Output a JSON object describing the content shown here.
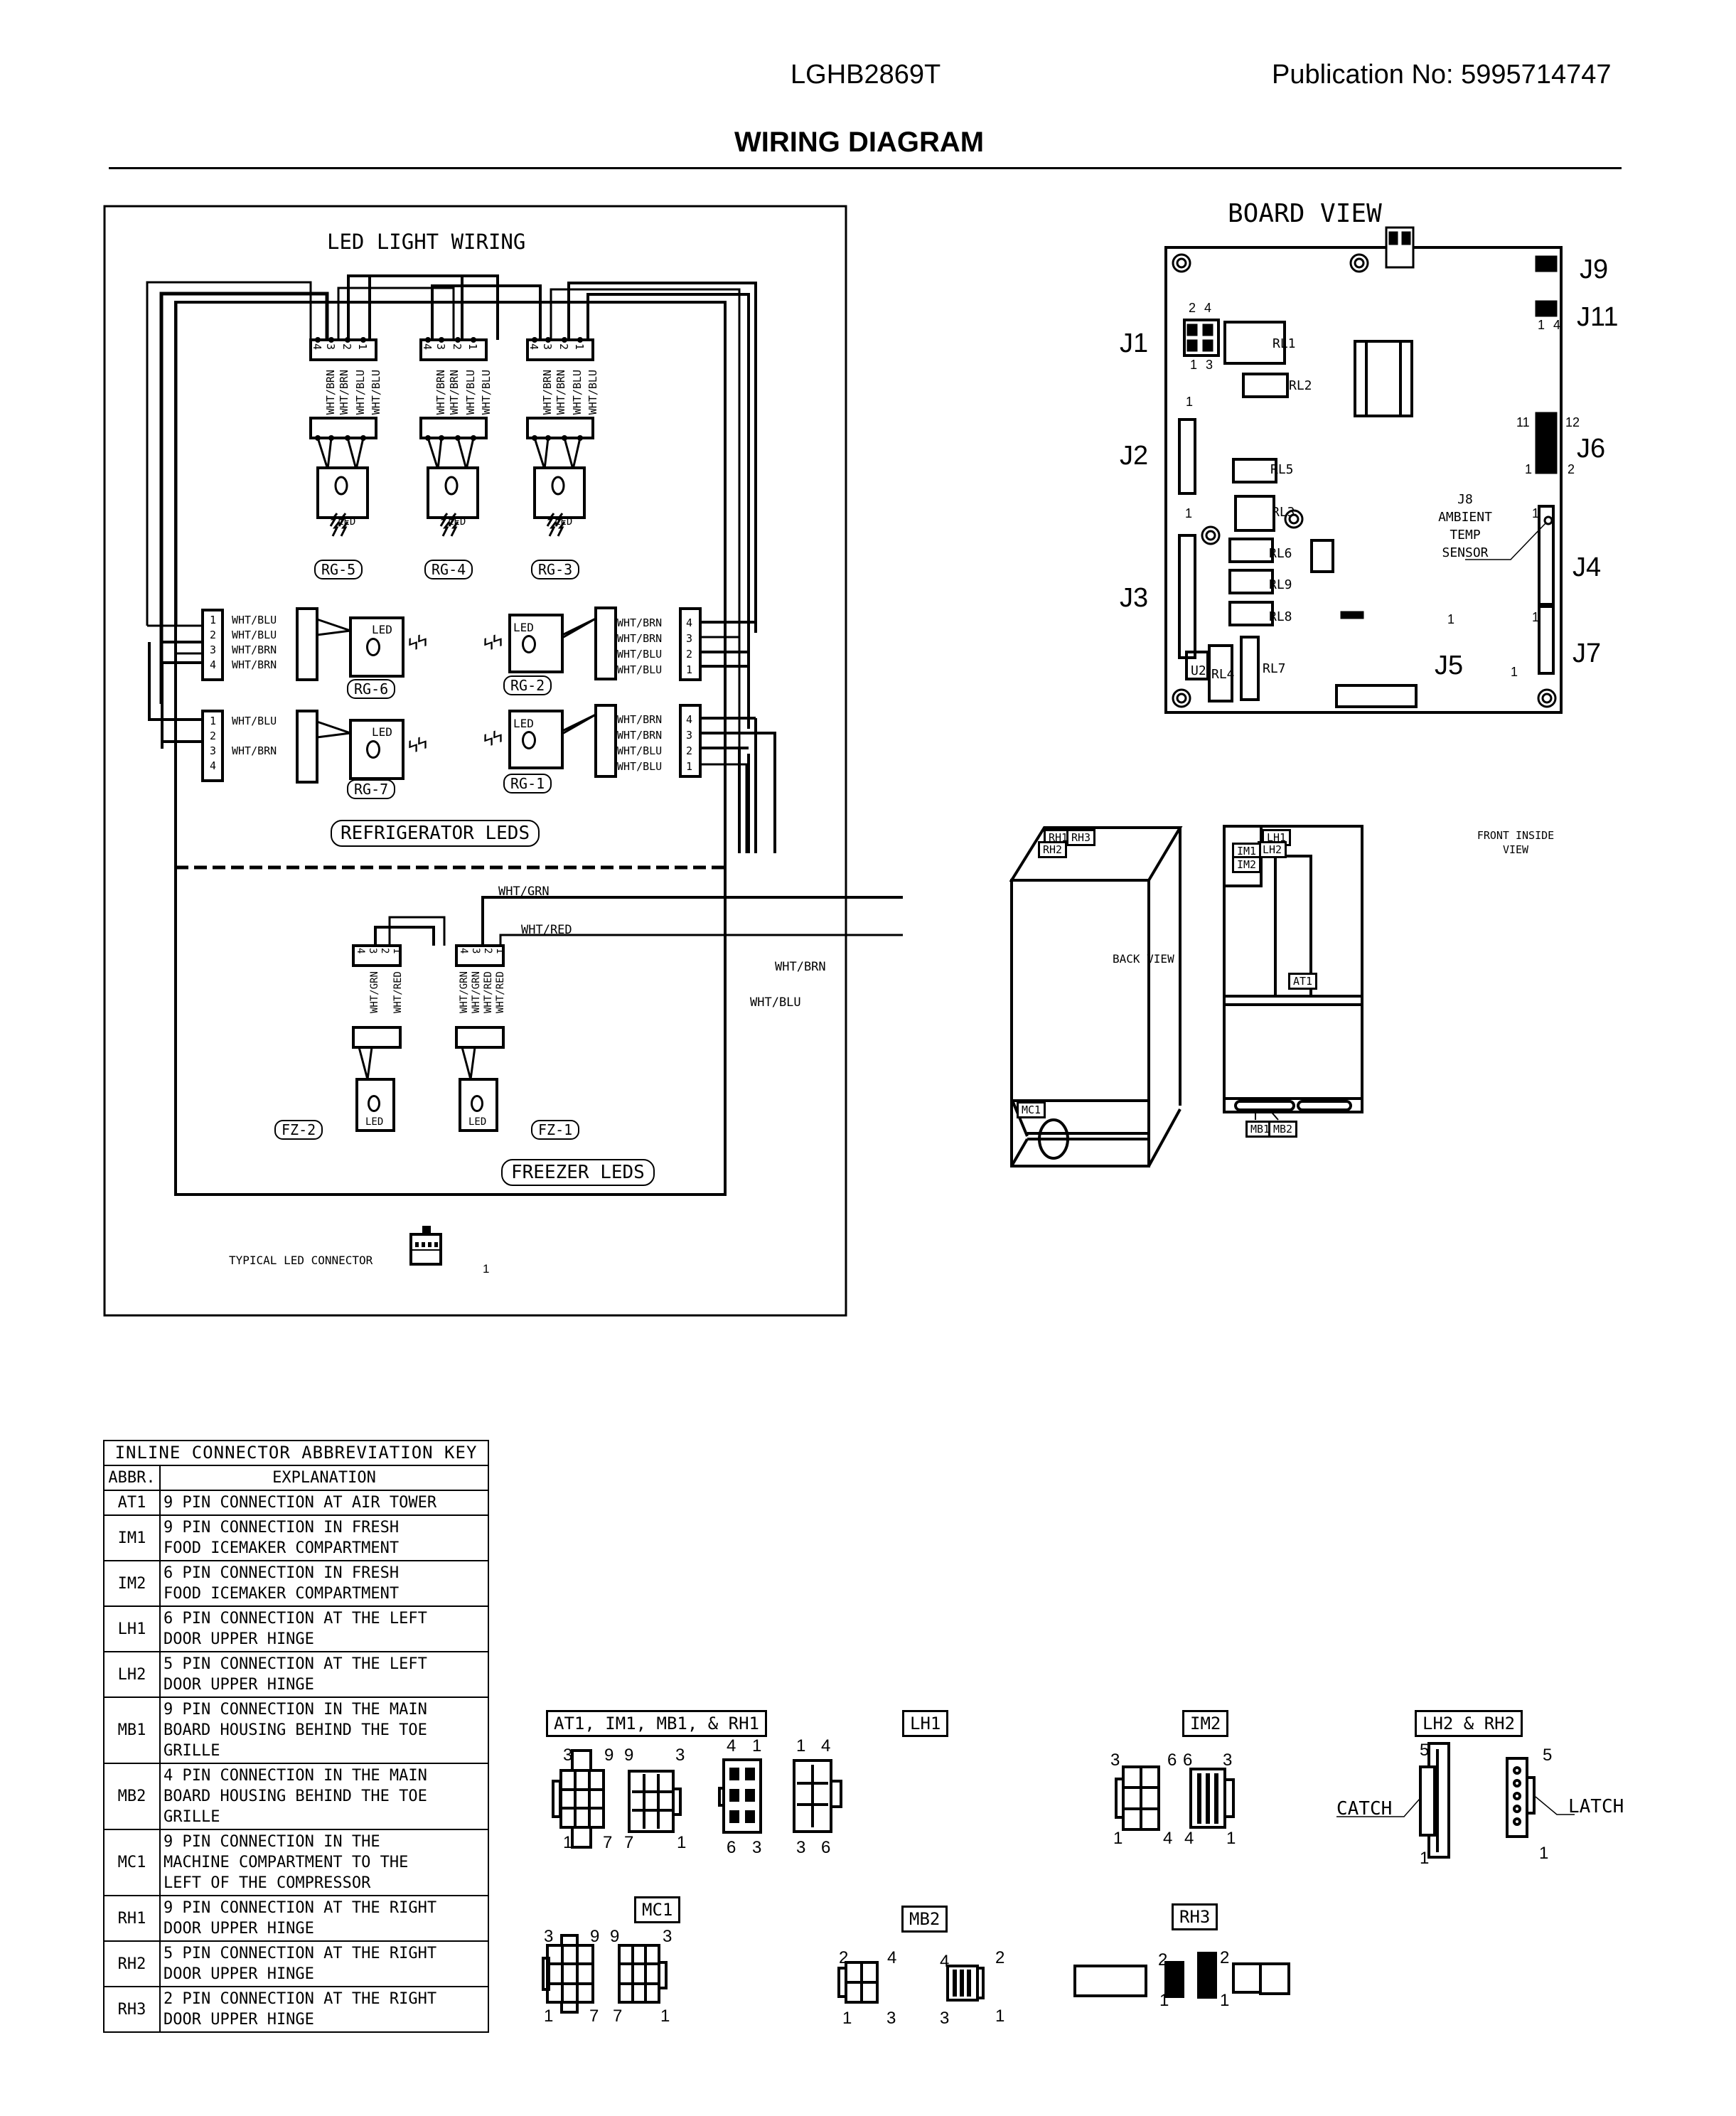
{
  "header": {
    "model": "LGHB2869T",
    "publication": "Publication No:  5995714747",
    "title": "WIRING DIAGRAM"
  },
  "led_panel": {
    "title": "LED LIGHT WIRING",
    "top_connectors": [
      {
        "label": "RG-5",
        "pins": [
          "4",
          "3",
          "2",
          "1"
        ],
        "wires": [
          "WHT/BRN",
          "WHT/BRN",
          "WHT/BLU",
          "WHT/BLU"
        ],
        "led_text": "LED"
      },
      {
        "label": "RG-4",
        "pins": [
          "4",
          "3",
          "2",
          "1"
        ],
        "wires": [
          "WHT/BRN",
          "WHT/BRN",
          "WHT/BLU",
          "WHT/BLU"
        ],
        "led_text": "LED"
      },
      {
        "label": "RG-3",
        "pins": [
          "4",
          "3",
          "2",
          "1"
        ],
        "wires": [
          "WHT/BRN",
          "WHT/BRN",
          "WHT/BLU",
          "WHT/BLU"
        ],
        "led_text": "LED"
      }
    ],
    "left_connectors": [
      {
        "label": "RG-6",
        "pins": [
          "1",
          "2",
          "3",
          "4"
        ],
        "wires": [
          "WHT/BLU",
          "WHT/BLU",
          "WHT/BRN",
          "WHT/BRN"
        ],
        "led_text": "LED"
      },
      {
        "label": "RG-7",
        "pins": [
          "1",
          "2",
          "3",
          "4"
        ],
        "wires": [
          "WHT/BLU",
          "",
          "WHT/BRN",
          ""
        ],
        "led_text": "LED"
      }
    ],
    "right_connectors": [
      {
        "label": "RG-2",
        "pins": [
          "4",
          "3",
          "2",
          "1"
        ],
        "wires": [
          "WHT/BRN",
          "WHT/BRN",
          "WHT/BLU",
          "WHT/BLU"
        ],
        "led_text": "LED"
      },
      {
        "label": "RG-1",
        "pins": [
          "4",
          "3",
          "2",
          "1"
        ],
        "wires": [
          "WHT/BRN",
          "WHT/BRN",
          "WHT/BLU",
          "WHT/BLU"
        ],
        "led_text": "LED"
      }
    ],
    "refrigerator_label": "REFRIGERATOR LEDS",
    "freezer_label": "FREEZER LEDS",
    "freezer_connectors": [
      {
        "label": "FZ-2",
        "pins": [
          "4",
          "3",
          "2",
          "1"
        ],
        "wires": [
          "WHT/GRN",
          "WHT/RED"
        ],
        "led_text": "LED"
      },
      {
        "label": "FZ-1",
        "pins": [
          "4",
          "3",
          "2",
          "1"
        ],
        "wires": [
          "WHT/GRN",
          "WHT/GRN",
          "WHT/RED",
          "WHT/RED"
        ],
        "led_text": "LED"
      }
    ],
    "outgoing_wires": [
      "WHT/GRN",
      "WHT/RED",
      "WHT/BRN",
      "WHT/BLU"
    ],
    "typical_connector_label": "TYPICAL LED CONNECTOR",
    "typical_connector_pin": "1"
  },
  "board_view": {
    "title": "BOARD VIEW",
    "connectors": [
      "J1",
      "J2",
      "J3",
      "J4",
      "J5",
      "J6",
      "J7",
      "J9",
      "J11"
    ],
    "j1_pins": {
      "top": [
        "2",
        "4"
      ],
      "bottom": [
        "1",
        "3"
      ]
    },
    "j11_pins": [
      "1",
      "4"
    ],
    "j6_pins": {
      "tl": "11",
      "tr": "12",
      "bl": "1",
      "br": "2"
    },
    "pin_one": "1",
    "relays": [
      "RL1",
      "RL2",
      "RL3",
      "RL4",
      "RL5",
      "RL6",
      "RL7",
      "RL8",
      "RL9"
    ],
    "u2": "U2",
    "j8_label": [
      "J8",
      "AMBIENT",
      "TEMP",
      "SENSOR"
    ]
  },
  "back_view": {
    "label": "BACK VIEW",
    "tags": [
      "RH1",
      "RH3",
      "RH2",
      "LH1",
      "LH2",
      "MC1"
    ]
  },
  "front_view": {
    "label": [
      "FRONT INSIDE",
      "VIEW"
    ],
    "tags": [
      "IM1",
      "IM2",
      "AT1",
      "MB1",
      "MB2"
    ]
  },
  "key_table": {
    "caption": "INLINE CONNECTOR ABBREVIATION KEY",
    "col_abbr": "ABBR.",
    "col_expl": "EXPLANATION",
    "rows": [
      {
        "abbr": "AT1",
        "lines": [
          "9 PIN CONNECTION AT AIR TOWER"
        ]
      },
      {
        "abbr": "IM1",
        "lines": [
          "9 PIN CONNECTION IN FRESH",
          "FOOD ICEMAKER COMPARTMENT"
        ]
      },
      {
        "abbr": "IM2",
        "lines": [
          "6 PIN CONNECTION IN FRESH",
          "FOOD ICEMAKER COMPARTMENT"
        ]
      },
      {
        "abbr": "LH1",
        "lines": [
          "6 PIN CONNECTION AT THE LEFT",
          "DOOR UPPER HINGE"
        ]
      },
      {
        "abbr": "LH2",
        "lines": [
          "5 PIN CONNECTION AT THE LEFT",
          "DOOR UPPER HINGE"
        ]
      },
      {
        "abbr": "MB1",
        "lines": [
          "9 PIN CONNECTION IN THE MAIN",
          "BOARD HOUSING BEHIND THE TOE",
          "GRILLE"
        ]
      },
      {
        "abbr": "MB2",
        "lines": [
          "4 PIN CONNECTION IN THE MAIN",
          "BOARD HOUSING BEHIND THE TOE",
          "GRILLE"
        ]
      },
      {
        "abbr": "MC1",
        "lines": [
          "9 PIN CONNECTION IN THE",
          "MACHINE COMPARTMENT TO THE",
          "LEFT OF THE COMPRESSOR"
        ]
      },
      {
        "abbr": "RH1",
        "lines": [
          "9 PIN CONNECTION AT THE RIGHT",
          "DOOR UPPER HINGE"
        ]
      },
      {
        "abbr": "RH2",
        "lines": [
          "5 PIN CONNECTION AT THE RIGHT",
          "DOOR UPPER HINGE"
        ]
      },
      {
        "abbr": "RH3",
        "lines": [
          "2 PIN CONNECTION AT THE RIGHT",
          "DOOR UPPER HINGE"
        ]
      }
    ]
  },
  "connector_details": {
    "at1_group": {
      "title": "AT1, IM1, MB1, & RH1",
      "left_pins": [
        "3",
        "9",
        "1",
        "7"
      ],
      "right_pins": [
        "9",
        "3",
        "7",
        "1"
      ]
    },
    "lh1": {
      "title": "LH1",
      "left_pins": [
        "4",
        "1",
        "6",
        "3"
      ],
      "right_pins": [
        "1",
        "4",
        "3",
        "6"
      ]
    },
    "im2": {
      "title": "IM2",
      "left_pins": [
        "3",
        "6",
        "1",
        "4"
      ],
      "right_pins": [
        "6",
        "3",
        "4",
        "1"
      ]
    },
    "lh2_rh2": {
      "title": "LH2 & RH2",
      "catch": "CATCH",
      "latch": "LATCH",
      "left_pins": [
        "5",
        "1"
      ],
      "right_pins": [
        "5",
        "1"
      ]
    },
    "mc1": {
      "title": "MC1",
      "left_pins": [
        "3",
        "9",
        "1",
        "7"
      ],
      "right_pins": [
        "9",
        "3",
        "7",
        "1"
      ]
    },
    "mb2": {
      "title": "MB2",
      "left_pins": [
        "2",
        "4",
        "1",
        "3"
      ],
      "right_pins": [
        "4",
        "2",
        "3",
        "1"
      ]
    },
    "rh3": {
      "title": "RH3",
      "left_pins": [
        "2",
        "1"
      ],
      "right_pins": [
        "2",
        "1"
      ]
    }
  }
}
